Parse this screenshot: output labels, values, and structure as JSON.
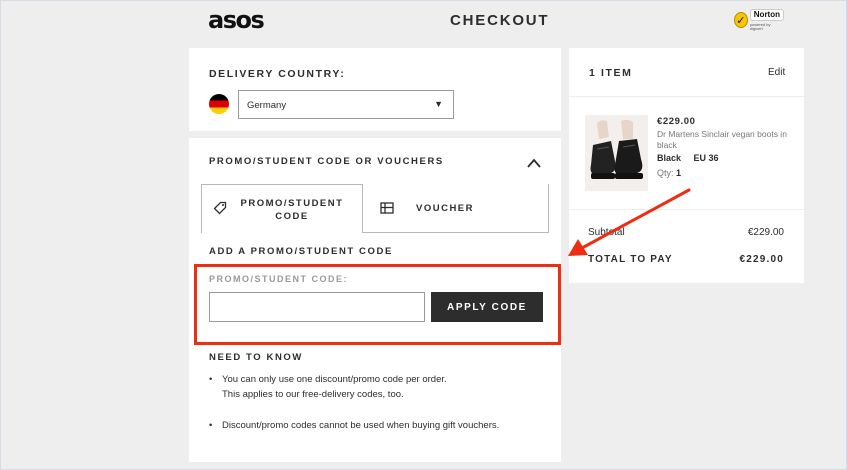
{
  "header": {
    "logo": "asos",
    "title": "CHECKOUT",
    "badge": {
      "name": "Norton",
      "sub": "powered by digicert"
    }
  },
  "delivery": {
    "heading": "DELIVERY COUNTRY:",
    "country_flag": "germany-flag",
    "selected_country": "Germany"
  },
  "promo": {
    "heading": "PROMO/STUDENT CODE OR VOUCHERS",
    "tabs": [
      {
        "label_line1": "PROMO/STUDENT",
        "label_line2": "CODE",
        "icon": "tag-icon",
        "active": true
      },
      {
        "label": "VOUCHER",
        "icon": "voucher-icon",
        "active": false
      }
    ],
    "subheading": "ADD A PROMO/STUDENT CODE",
    "field_label": "PROMO/STUDENT CODE:",
    "field_value": "",
    "apply_label": "APPLY CODE",
    "need_to_know": {
      "heading": "NEED TO KNOW",
      "items": [
        {
          "line1": "You can only use one discount/promo code per order.",
          "line2": "This applies to our free-delivery codes, too."
        },
        {
          "line1": "Discount/promo codes cannot be used when buying gift vouchers."
        }
      ]
    }
  },
  "summary": {
    "heading": "1 ITEM",
    "edit_label": "Edit",
    "item": {
      "price": "€229.00",
      "name": "Dr Martens Sinclair vegan boots in black",
      "color": "Black",
      "size": "EU 36",
      "qty_label": "Qty:",
      "qty": "1"
    },
    "subtotal_label": "Subtotal",
    "subtotal_value": "€229.00",
    "total_label": "TOTAL TO PAY",
    "total_value": "€229.00"
  },
  "colors": {
    "annotation": "#ef2d13",
    "button": "#2d2d2d",
    "background": "#eeeeee"
  }
}
